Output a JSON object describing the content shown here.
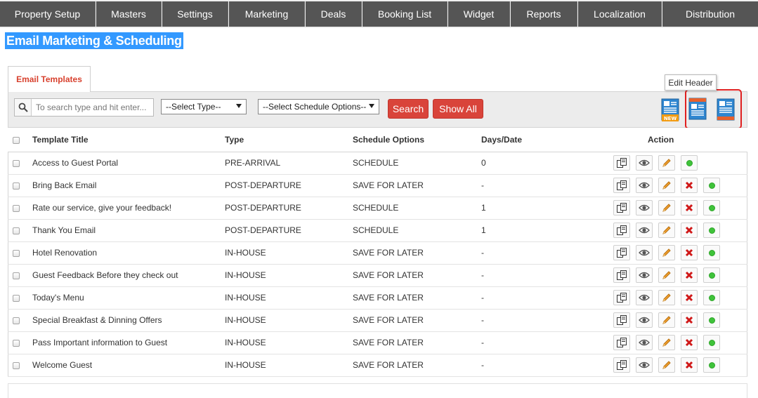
{
  "nav": {
    "items": [
      {
        "label": "Property Setup"
      },
      {
        "label": "Masters"
      },
      {
        "label": "Settings"
      },
      {
        "label": "Marketing"
      },
      {
        "label": "Deals"
      },
      {
        "label": "Booking List"
      },
      {
        "label": "Widget"
      },
      {
        "label": "Reports"
      },
      {
        "label": "Localization"
      },
      {
        "label": "Distribution"
      }
    ]
  },
  "page": {
    "title": "Email Marketing & Scheduling"
  },
  "tabs": {
    "email_templates": "Email Templates"
  },
  "toolbar": {
    "search_placeholder": "To search type and hit enter...",
    "type_select": "--Select Type--",
    "schedule_select": "--Select Schedule Options--",
    "search_label": "Search",
    "show_all_label": "Show All",
    "new_icon_text": "NEW",
    "tooltip": "Edit Header",
    "colors": {
      "accent_red": "#d9443a",
      "nav_bg": "#555555",
      "highlight": "#e02020"
    }
  },
  "table": {
    "headers": {
      "title": "Template Title",
      "type": "Type",
      "schedule": "Schedule Options",
      "days": "Days/Date",
      "action": "Action"
    },
    "rows": [
      {
        "title": "Access to Guest Portal",
        "type": "PRE-ARRIVAL",
        "schedule": "SCHEDULE",
        "days": "0"
      },
      {
        "title": "Bring Back Email",
        "type": "POST-DEPARTURE",
        "schedule": "SAVE FOR LATER",
        "days": "-"
      },
      {
        "title": "Rate our service, give your feedback!",
        "type": "POST-DEPARTURE",
        "schedule": "SCHEDULE",
        "days": "1"
      },
      {
        "title": "Thank You Email",
        "type": "POST-DEPARTURE",
        "schedule": "SCHEDULE",
        "days": "1"
      },
      {
        "title": "Hotel Renovation",
        "type": "IN-HOUSE",
        "schedule": "SAVE FOR LATER",
        "days": "-"
      },
      {
        "title": "Guest Feedback Before they check out",
        "type": "IN-HOUSE",
        "schedule": "SAVE FOR LATER",
        "days": "-"
      },
      {
        "title": "Today's Menu",
        "type": "IN-HOUSE",
        "schedule": "SAVE FOR LATER",
        "days": "-"
      },
      {
        "title": "Special Breakfast & Dinning Offers",
        "type": "IN-HOUSE",
        "schedule": "SAVE FOR LATER",
        "days": "-"
      },
      {
        "title": "Pass Important information to Guest",
        "type": "IN-HOUSE",
        "schedule": "SAVE FOR LATER",
        "days": "-"
      },
      {
        "title": "Welcome Guest",
        "type": "IN-HOUSE",
        "schedule": "SAVE FOR LATER",
        "days": "-"
      }
    ]
  }
}
